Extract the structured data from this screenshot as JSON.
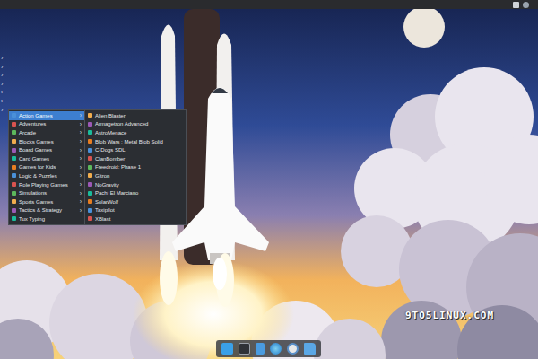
{
  "desktop": {
    "watermark": "9TO5LINUX.COM"
  },
  "side_arrows": [
    "›",
    "›",
    "›",
    "›",
    "›",
    "›",
    "›"
  ],
  "menu": {
    "submenu_arrow": "›",
    "categories": [
      {
        "label": "Action Games",
        "selected": true,
        "has_submenu": true
      },
      {
        "label": "Adventures",
        "selected": false,
        "has_submenu": true
      },
      {
        "label": "Arcade",
        "selected": false,
        "has_submenu": true
      },
      {
        "label": "Blocks Games",
        "selected": false,
        "has_submenu": true
      },
      {
        "label": "Board Games",
        "selected": false,
        "has_submenu": true
      },
      {
        "label": "Card Games",
        "selected": false,
        "has_submenu": true
      },
      {
        "label": "Games for Kids",
        "selected": false,
        "has_submenu": true
      },
      {
        "label": "Logic & Puzzles",
        "selected": false,
        "has_submenu": true
      },
      {
        "label": "Role Playing Games",
        "selected": false,
        "has_submenu": true
      },
      {
        "label": "Simulations",
        "selected": false,
        "has_submenu": true
      },
      {
        "label": "Sports Games",
        "selected": false,
        "has_submenu": true
      },
      {
        "label": "Tactics & Strategy",
        "selected": false,
        "has_submenu": true
      },
      {
        "label": "Tux Typing",
        "selected": false,
        "has_submenu": false
      }
    ]
  },
  "submenu": {
    "items": [
      "Alien Blaster",
      "Armagetron Advanced",
      "AstroMenace",
      "Blob Wars : Metal Blob Solid",
      "C-Dogs SDL",
      "ClanBomber",
      "Freedroid: Phase 1",
      "Gltron",
      "NoGravity",
      "Pachi El Marciano",
      "SolarWolf",
      "Taxipilot",
      "XBlast"
    ]
  }
}
